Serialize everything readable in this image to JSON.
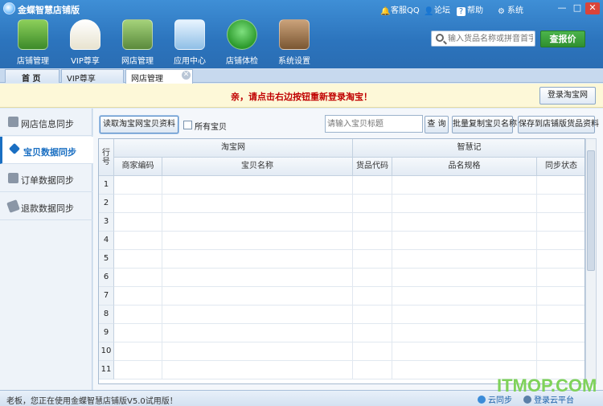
{
  "app": {
    "title": "金蝶智慧店铺版",
    "links": [
      "客服QQ",
      "论坛",
      "帮助",
      "系统"
    ],
    "window_controls": [
      "—",
      "□",
      "✕"
    ]
  },
  "toolbar": {
    "items": [
      {
        "label": "店铺管理",
        "icon": "store-icon"
      },
      {
        "label": "VIP尊享",
        "icon": "vip-icon"
      },
      {
        "label": "网店管理",
        "icon": "online-shop-icon"
      },
      {
        "label": "应用中心",
        "icon": "app-center-icon"
      },
      {
        "label": "店铺体检",
        "icon": "health-check-icon"
      },
      {
        "label": "系统设置",
        "icon": "settings-icon"
      }
    ],
    "search_placeholder": "输入货品名称或拼音首字母",
    "check_price_label": "查报价"
  },
  "tabs": [
    {
      "label": "首 页"
    },
    {
      "label": "VIP尊享"
    },
    {
      "label": "网店管理"
    }
  ],
  "notice": {
    "message": "亲，请点击右边按钮重新登录淘宝！",
    "button": "登录淘宝网"
  },
  "sidebar": {
    "items": [
      {
        "label": "网店信息同步"
      },
      {
        "label": "宝贝数据同步"
      },
      {
        "label": "订单数据同步"
      },
      {
        "label": "退款数据同步"
      }
    ]
  },
  "actions": {
    "read_button": "读取淘宝网宝贝资料",
    "all_items_label": "所有宝贝",
    "title_placeholder": "请输入宝贝标题",
    "query_button": "查 询",
    "batch_copy_button": "批量复制宝贝名称",
    "save_button": "保存到店铺版货品资料"
  },
  "grid": {
    "row_header": "行号",
    "group_taobao": "淘宝网",
    "group_zhihuiji": "智慧记",
    "columns": [
      "商家编码",
      "宝贝名称",
      "货品代码",
      "品名规格",
      "同步状态"
    ],
    "rows": [
      "1",
      "2",
      "3",
      "4",
      "5",
      "6",
      "7",
      "8",
      "9",
      "10",
      "11"
    ]
  },
  "status": {
    "text": "老板，您正在使用金蝶智慧店铺版V5.0试用版！",
    "cloud_sync": "云同步",
    "cloud_login": "登录云平台"
  },
  "watermark": "ITMOP.COM",
  "colors": {
    "accent": "#2c74bd",
    "notice_text": "#c00000",
    "watermark": "#7fd25a"
  }
}
